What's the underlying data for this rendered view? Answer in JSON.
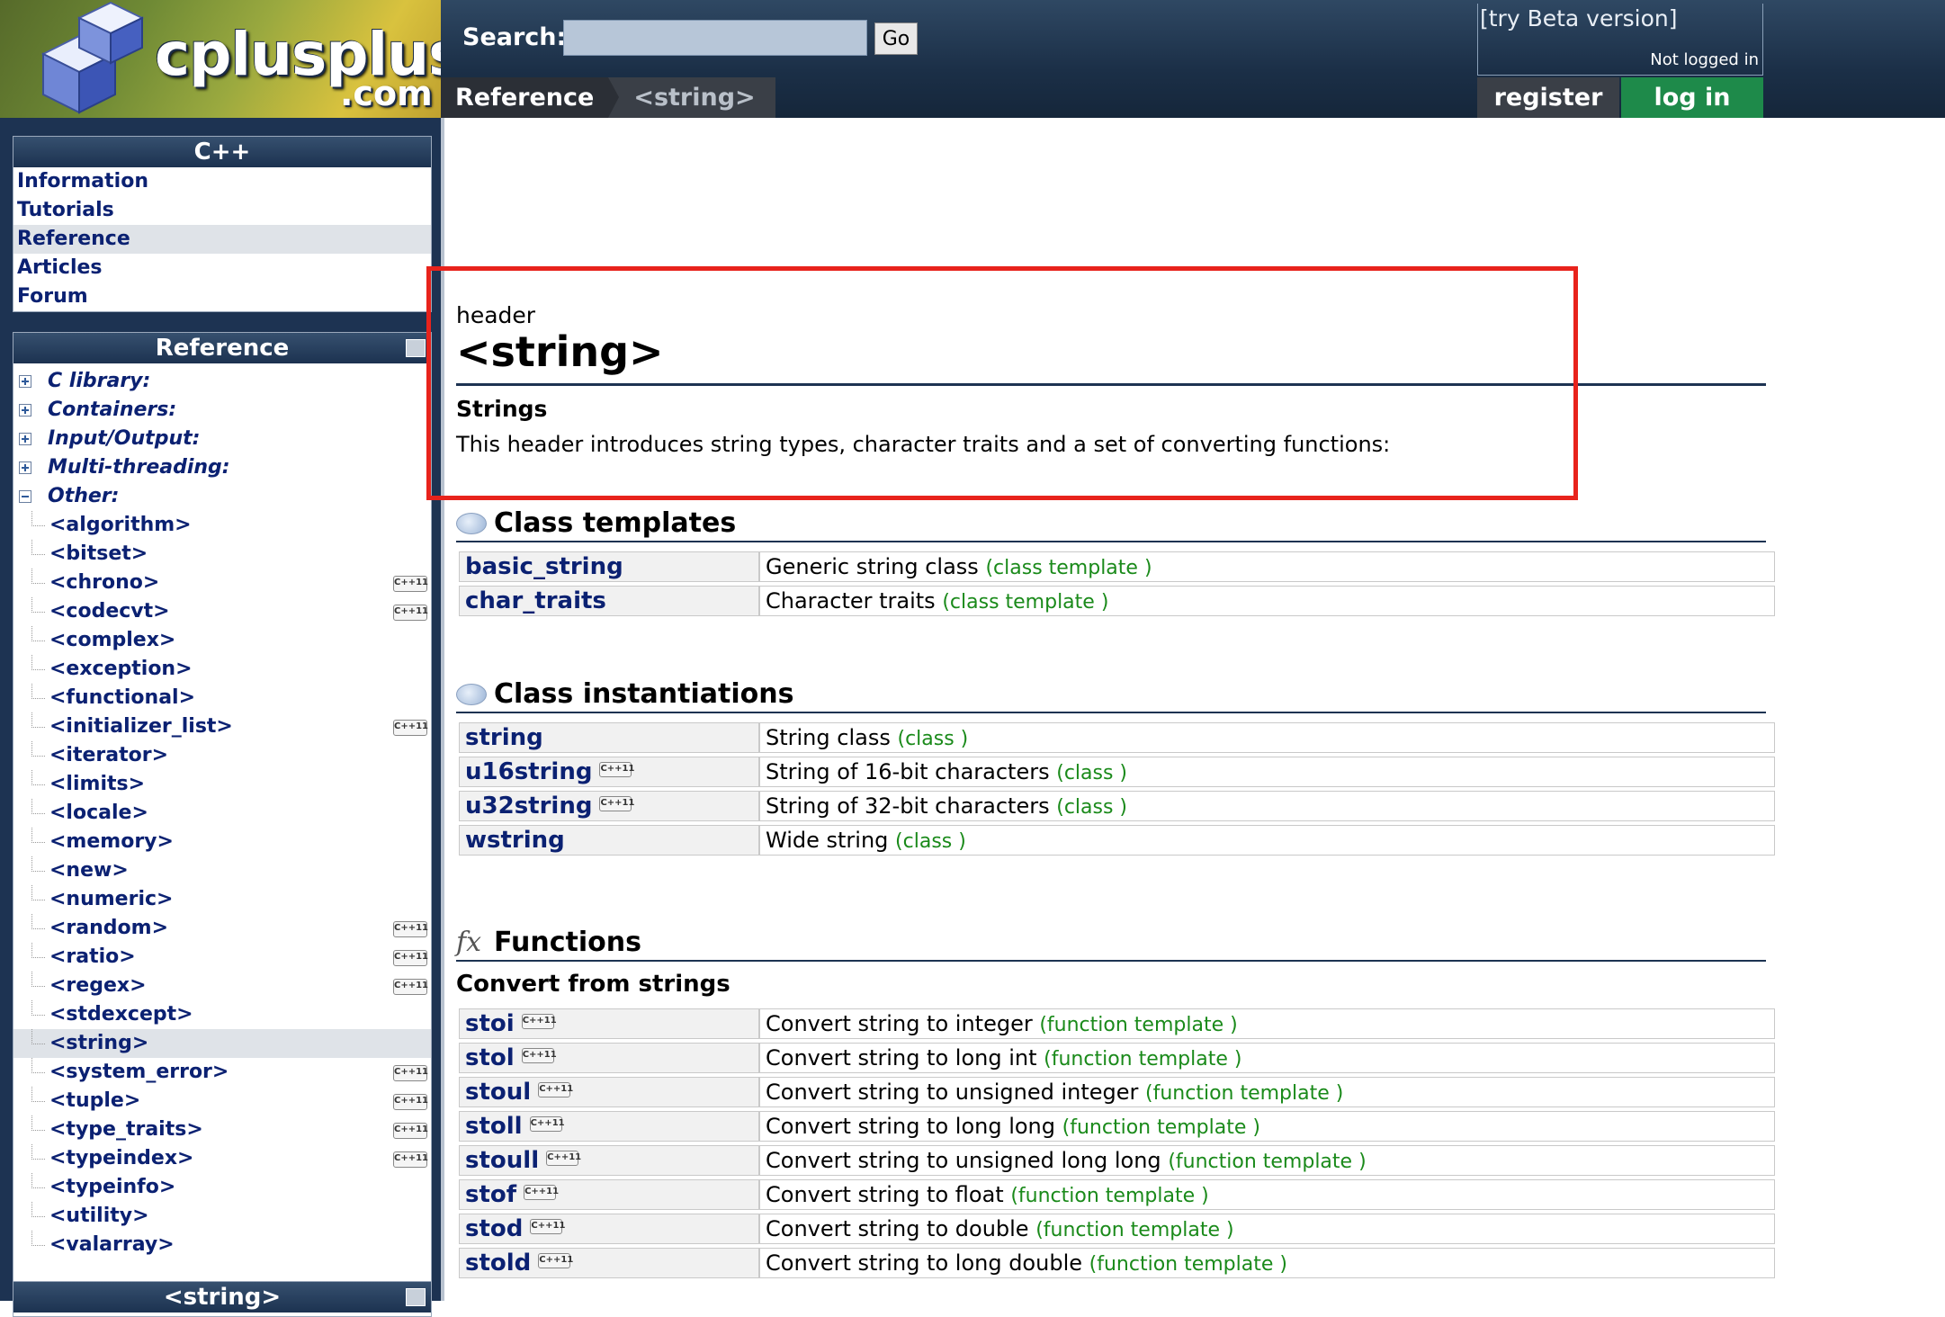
{
  "header": {
    "brand": "cplusplus",
    "brand_domain": ".com",
    "search_label": "Search:",
    "search_value": "",
    "go_label": "Go",
    "breadcrumbs": [
      "Reference",
      "<string>"
    ],
    "beta_link": "[try Beta version]",
    "login_status": "Not logged in",
    "register_label": "register",
    "login_label": "log in"
  },
  "sidebar": {
    "cpp_panel": {
      "title": "C++",
      "items": [
        "Information",
        "Tutorials",
        "Reference",
        "Articles",
        "Forum"
      ]
    },
    "reference_panel": {
      "title": "Reference",
      "groups": [
        "C library:",
        "Containers:",
        "Input/Output:",
        "Multi-threading:",
        "Other:"
      ],
      "headers": [
        {
          "name": "<algorithm>",
          "cpp11": false
        },
        {
          "name": "<bitset>",
          "cpp11": false
        },
        {
          "name": "<chrono>",
          "cpp11": true
        },
        {
          "name": "<codecvt>",
          "cpp11": true
        },
        {
          "name": "<complex>",
          "cpp11": false
        },
        {
          "name": "<exception>",
          "cpp11": false
        },
        {
          "name": "<functional>",
          "cpp11": false
        },
        {
          "name": "<initializer_list>",
          "cpp11": true
        },
        {
          "name": "<iterator>",
          "cpp11": false
        },
        {
          "name": "<limits>",
          "cpp11": false
        },
        {
          "name": "<locale>",
          "cpp11": false
        },
        {
          "name": "<memory>",
          "cpp11": false
        },
        {
          "name": "<new>",
          "cpp11": false
        },
        {
          "name": "<numeric>",
          "cpp11": false
        },
        {
          "name": "<random>",
          "cpp11": true
        },
        {
          "name": "<ratio>",
          "cpp11": true
        },
        {
          "name": "<regex>",
          "cpp11": true
        },
        {
          "name": "<stdexcept>",
          "cpp11": false
        },
        {
          "name": "<string>",
          "cpp11": false
        },
        {
          "name": "<system_error>",
          "cpp11": true
        },
        {
          "name": "<tuple>",
          "cpp11": true
        },
        {
          "name": "<type_traits>",
          "cpp11": true
        },
        {
          "name": "<typeindex>",
          "cpp11": true
        },
        {
          "name": "<typeinfo>",
          "cpp11": false
        },
        {
          "name": "<utility>",
          "cpp11": false
        },
        {
          "name": "<valarray>",
          "cpp11": false
        }
      ],
      "badge_text": "C++11"
    },
    "string_panel_title": "<string>"
  },
  "main": {
    "kind": "header",
    "title": "<string>",
    "summary_heading": "Strings",
    "summary_text": "This header introduces string types, character traits and a set of converting functions:",
    "class_templates": {
      "heading": "Class templates",
      "rows": [
        {
          "name": "basic_string",
          "desc": "Generic string class",
          "kind": "(class template )",
          "cpp11": false
        },
        {
          "name": "char_traits",
          "desc": "Character traits",
          "kind": "(class template )",
          "cpp11": false
        }
      ]
    },
    "class_instantiations": {
      "heading": "Class instantiations",
      "rows": [
        {
          "name": "string",
          "desc": "String class",
          "kind": "(class )",
          "cpp11": false
        },
        {
          "name": "u16string",
          "desc": "String of 16-bit characters",
          "kind": "(class )",
          "cpp11": true
        },
        {
          "name": "u32string",
          "desc": "String of 32-bit characters",
          "kind": "(class )",
          "cpp11": true
        },
        {
          "name": "wstring",
          "desc": "Wide string",
          "kind": "(class )",
          "cpp11": false
        }
      ]
    },
    "functions": {
      "heading": "Functions",
      "icon_text": "fx",
      "subheading": "Convert from strings",
      "rows": [
        {
          "name": "stoi",
          "desc": "Convert string to integer",
          "kind": "(function template )",
          "cpp11": true
        },
        {
          "name": "stol",
          "desc": "Convert string to long int",
          "kind": "(function template )",
          "cpp11": true
        },
        {
          "name": "stoul",
          "desc": "Convert string to unsigned integer",
          "kind": "(function template )",
          "cpp11": true
        },
        {
          "name": "stoll",
          "desc": "Convert string to long long",
          "kind": "(function template )",
          "cpp11": true
        },
        {
          "name": "stoull",
          "desc": "Convert string to unsigned long long",
          "kind": "(function template )",
          "cpp11": true
        },
        {
          "name": "stof",
          "desc": "Convert string to float",
          "kind": "(function template )",
          "cpp11": true
        },
        {
          "name": "stod",
          "desc": "Convert string to double",
          "kind": "(function template )",
          "cpp11": true
        },
        {
          "name": "stold",
          "desc": "Convert string to long double",
          "kind": "(function template )",
          "cpp11": true
        }
      ]
    }
  },
  "colors": {
    "header_bg": "#1b2f47",
    "link": "#0b2172",
    "kind_green": "#1a8a1a",
    "login_green": "#1e8a4a",
    "highlight_red": "#e8231c"
  }
}
